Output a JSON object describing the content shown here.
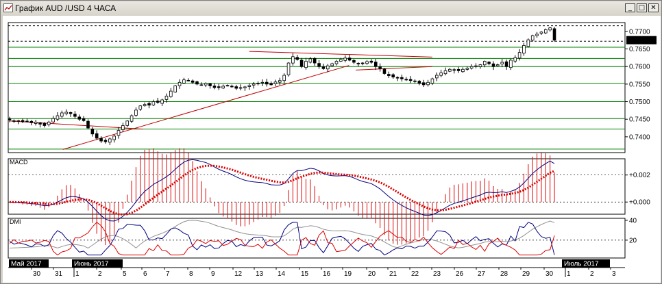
{
  "window": {
    "title": "График AUD /USD  4 ЧАСА",
    "buttons": {
      "minimize": "_",
      "maximize": "□",
      "close": "✕"
    }
  },
  "colors": {
    "bull": "#ffffff",
    "bear": "#000000",
    "trend": "#c00000",
    "level": "#008000",
    "macd": "#000080",
    "signal": "#dd0000",
    "plus_di": "#000080",
    "minus_di": "#dd0000",
    "adx": "#909090"
  },
  "chart_data": {
    "type": "candlestick",
    "price_panel": {
      "yticks": [
        "0.7700",
        "0.7650",
        "0.7600",
        "0.7550",
        "0.7500",
        "0.7450",
        "0.7400"
      ],
      "current_price_label": "0.7675",
      "current_price": 0.7675,
      "horizontal_levels": [
        0.7716,
        0.7672,
        0.7655,
        0.7623,
        0.76,
        0.7552,
        0.75,
        0.7452,
        0.7422,
        0.7365
      ],
      "trendlines": [
        {
          "from": [
            "Jun 2 12:00",
            0.7364
          ],
          "to": [
            "Jun 16 20:00",
            0.7603
          ]
        },
        {
          "from": [
            "May 30 00:00",
            0.7445
          ],
          "to": [
            "Jun 4 00:00",
            0.7422
          ]
        },
        {
          "from": [
            "Jun 14 12:00",
            0.7643
          ],
          "to": [
            "Jun 22 00:00",
            0.7627
          ]
        },
        {
          "from": [
            "Jun 17 00:00",
            0.759
          ],
          "to": [
            "Jun 22 00:00",
            0.76
          ]
        }
      ],
      "closes": [
        0.7448,
        0.7445,
        0.7446,
        0.7443,
        0.7444,
        0.744,
        0.7442,
        0.7436,
        0.7432,
        0.7442,
        0.7452,
        0.746,
        0.7468,
        0.747,
        0.7466,
        0.7458,
        0.745,
        0.7446,
        0.7425,
        0.7408,
        0.7396,
        0.7388,
        0.7386,
        0.7394,
        0.7402,
        0.7418,
        0.7432,
        0.7445,
        0.746,
        0.7476,
        0.7488,
        0.7492,
        0.749,
        0.75,
        0.7498,
        0.7505,
        0.7516,
        0.753,
        0.7545,
        0.7555,
        0.7562,
        0.756,
        0.7555,
        0.755,
        0.7548,
        0.7552,
        0.7545,
        0.754,
        0.754,
        0.7544,
        0.7546,
        0.7542,
        0.7538,
        0.754,
        0.7542,
        0.7546,
        0.755,
        0.7552,
        0.7555,
        0.755,
        0.7548,
        0.7556,
        0.756,
        0.7575,
        0.761,
        0.7628,
        0.762,
        0.76,
        0.7615,
        0.7622,
        0.761,
        0.76,
        0.7594,
        0.7602,
        0.7608,
        0.7615,
        0.762,
        0.7624,
        0.7618,
        0.7612,
        0.7608,
        0.761,
        0.7614,
        0.7612,
        0.76,
        0.7594,
        0.758,
        0.7574,
        0.757,
        0.7568,
        0.7565,
        0.7562,
        0.756,
        0.7558,
        0.7552,
        0.7548,
        0.7555,
        0.7565,
        0.7575,
        0.7582,
        0.7588,
        0.7592,
        0.759,
        0.7588,
        0.7592,
        0.7595,
        0.76,
        0.7602,
        0.7605,
        0.7615,
        0.7608,
        0.76,
        0.7605,
        0.7612,
        0.76,
        0.7618,
        0.7625,
        0.764,
        0.766,
        0.7676,
        0.7688,
        0.7692,
        0.7698,
        0.7705,
        0.771,
        0.7675
      ],
      "ylim": [
        0.7355,
        0.7725
      ]
    },
    "macd_panel": {
      "label": "MACD",
      "yticks": [
        "+0.002",
        "+0.000"
      ],
      "ylim": [
        -0.0009,
        0.0032
      ]
    },
    "dmi_panel": {
      "label": "DMI",
      "yticks": [
        "40",
        "20"
      ],
      "ylim": [
        2,
        42
      ]
    },
    "x_axis": {
      "month_labels": [
        "Май 2017",
        "Июнь 2017",
        "Июль 2017"
      ],
      "ticks": [
        "30",
        "31",
        "1",
        "2",
        "5",
        "6",
        "7",
        "8",
        "9",
        "12",
        "13",
        "14",
        "15",
        "16",
        "19",
        "20",
        "21",
        "22",
        "23",
        "26",
        "27",
        "28",
        "29",
        "30",
        "1",
        "2",
        "3"
      ]
    }
  }
}
